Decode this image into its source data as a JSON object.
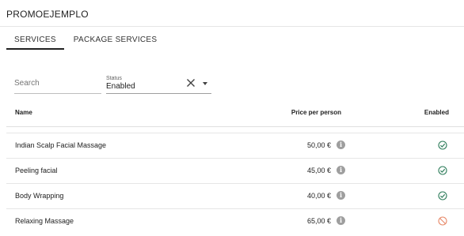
{
  "header": {
    "title": "PROMOEJEMPLO"
  },
  "tabs": [
    {
      "label": "SERVICES",
      "active": true
    },
    {
      "label": "PACKAGE SERVICES",
      "active": false
    }
  ],
  "filters": {
    "search_placeholder": "Search",
    "search_value": "",
    "status_label": "Status",
    "status_value": "Enabled"
  },
  "table": {
    "columns": {
      "name": "Name",
      "price": "Price per person",
      "enabled": "Enabled"
    },
    "rows": [
      {
        "name": "Indian Scalp Facial Massage",
        "price": "50,00 €",
        "enabled": true
      },
      {
        "name": "Peeling facial",
        "price": "45,00 €",
        "enabled": true
      },
      {
        "name": "Body Wrapping",
        "price": "40,00 €",
        "enabled": true
      },
      {
        "name": "Relaxing Massage",
        "price": "65,00 €",
        "enabled": false
      }
    ]
  },
  "icons": {
    "info": "info-icon",
    "enabled": "check-circle-icon",
    "disabled": "block-icon",
    "clear": "close-icon",
    "dropdown": "arrow-drop-down-icon"
  },
  "colors": {
    "enabled": "#2e7d5b",
    "disabled": "#e88a6a",
    "info": "#9e9e9e",
    "tab_indicator": "#212121"
  }
}
